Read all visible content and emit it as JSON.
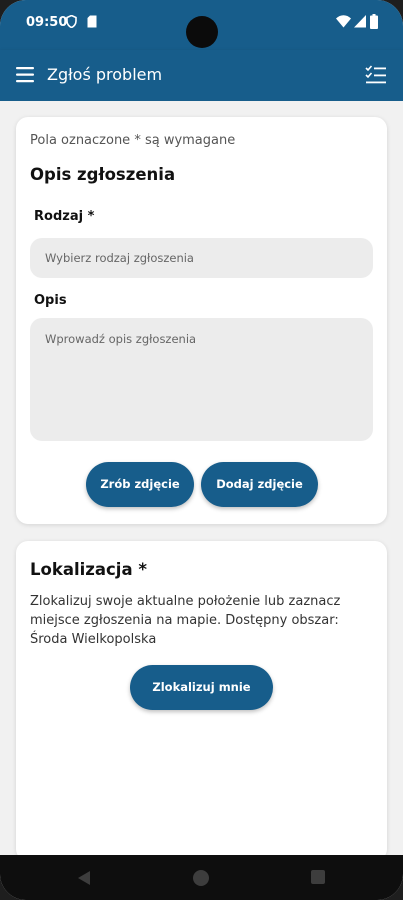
{
  "status_bar": {
    "time": "09:50"
  },
  "app_bar": {
    "title": "Zgłoś problem"
  },
  "form": {
    "required_note": "Pola oznaczone * są wymagane",
    "heading": "Opis zgłoszenia",
    "type_label": "Rodzaj *",
    "type_placeholder": "Wybierz rodzaj zgłoszenia",
    "description_label": "Opis",
    "description_placeholder": "Wprowadź opis zgłoszenia",
    "take_photo_label": "Zrób zdjęcie",
    "add_photo_label": "Dodaj zdjęcie"
  },
  "location": {
    "heading": "Lokalizacja *",
    "description": "Zlokalizuj swoje aktualne położenie lub zaznacz miejsce zgłoszenia na mapie. Dostępny obszar: Środa Wielkopolska",
    "locate_label": "Zlokalizuj mnie"
  },
  "colors": {
    "primary": "#175d8b",
    "background": "#f1f1f1",
    "card": "#ffffff",
    "input": "#ececec"
  }
}
